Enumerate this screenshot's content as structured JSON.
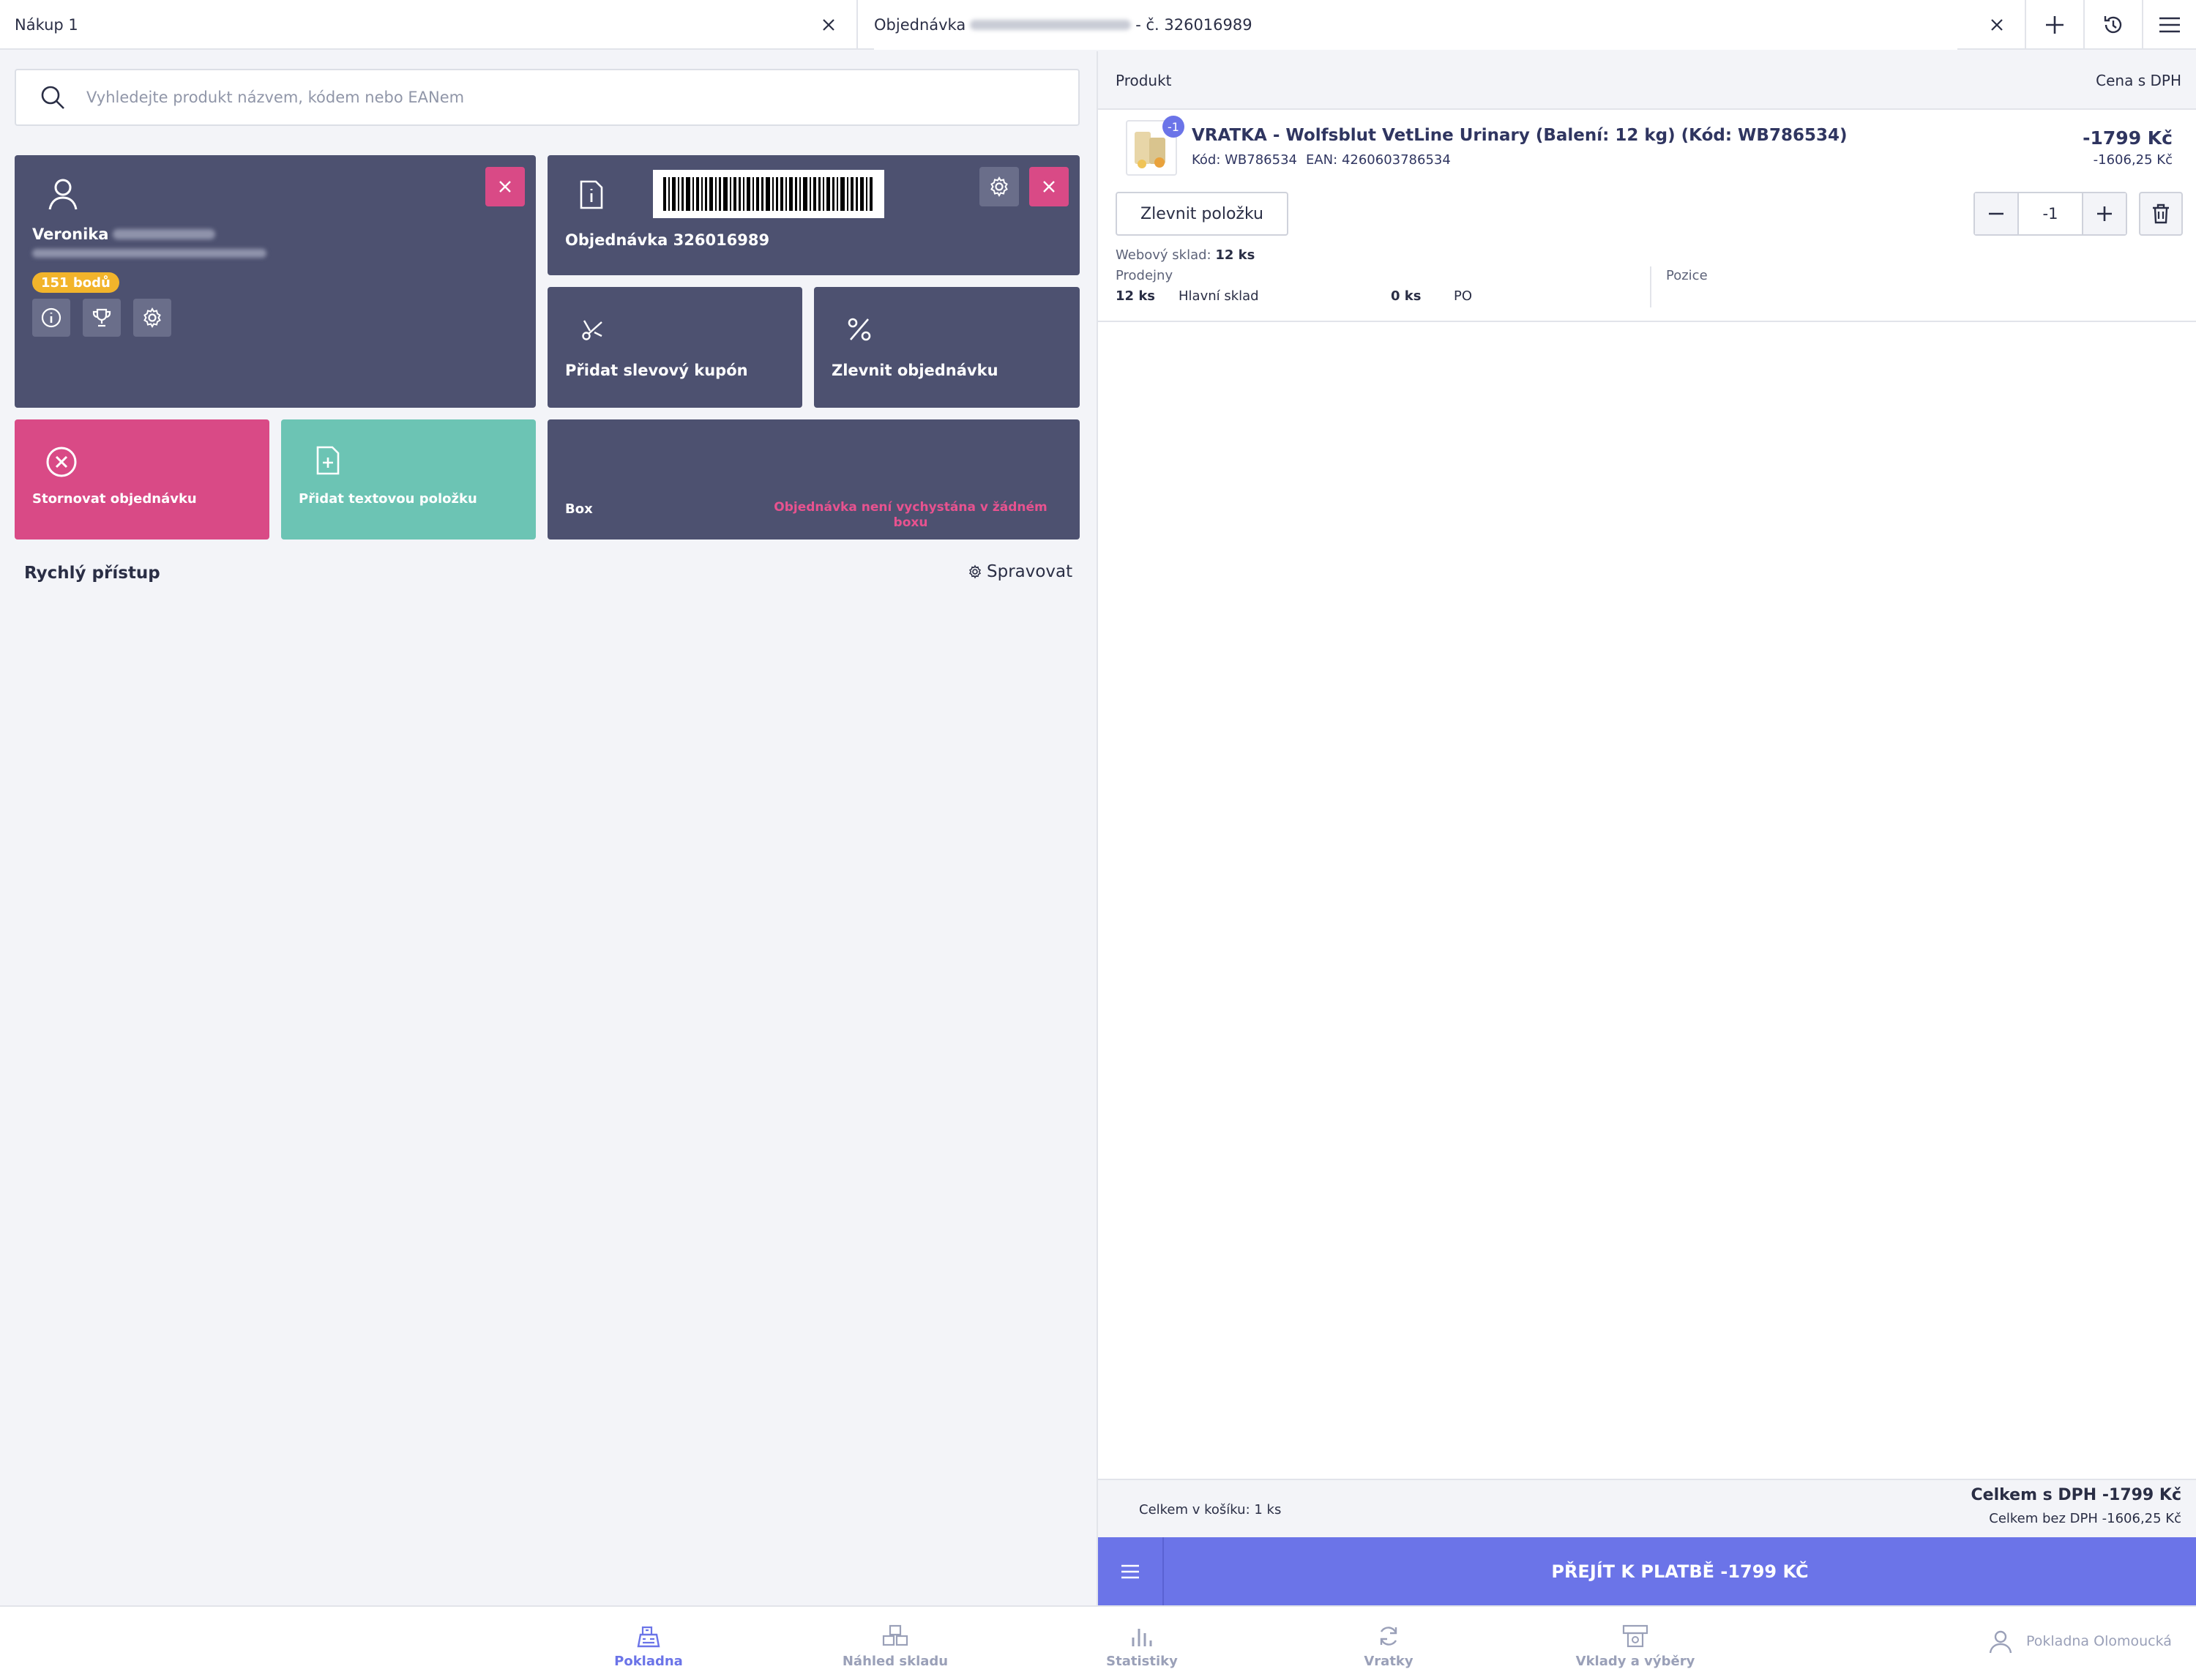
{
  "tabs": {
    "tab1_label": "Nákup 1",
    "tab2_prefix": "Objednávka",
    "tab2_suffix": "- č. 326016989"
  },
  "search": {
    "placeholder": "Vyhledejte produkt názvem, kódem nebo EANem"
  },
  "customer": {
    "first_name": "Veronika",
    "points": "151 bodů"
  },
  "order_tile": {
    "title": "Objednávka 326016989"
  },
  "actions": {
    "coupon": "Přidat slevový kupón",
    "discount_order": "Zlevnit objednávku",
    "cancel_order": "Stornovat objednávku",
    "add_text_item": "Přidat textovou položku"
  },
  "box": {
    "label": "Box",
    "status": "Objednávka není vychystána v žádném boxu"
  },
  "quick_access": {
    "title": "Rychlý přístup",
    "manage": "Spravovat"
  },
  "cart": {
    "col_product": "Produkt",
    "col_price": "Cena s DPH",
    "item": {
      "badge": "-1",
      "name": "VRATKA - Wolfsblut VetLine Urinary (Balení: 12 kg) (Kód: WB786534)",
      "code": "Kód: WB786534",
      "ean": "EAN: 4260603786534",
      "price": "-1799 Kč",
      "price_without_vat": "-1606,25 Kč",
      "discount_button": "Zlevnit položku",
      "quantity": "-1",
      "web_stock_label": "Webový sklad:",
      "web_stock_value": "12 ks",
      "stores_label": "Prodejny",
      "positions_label": "Pozice",
      "store_qty": "12 ks",
      "store_name": "Hlavní sklad",
      "store2_qty": "0 ks",
      "store2_name": "PO"
    },
    "total_count": "Celkem v košíku: 1 ks",
    "total_with_vat": "Celkem s DPH -1799 Kč",
    "total_without_vat": "Celkem bez DPH -1606,25 Kč",
    "pay_button": "PŘEJÍT K PLATBĚ -1799 KČ"
  },
  "nav": {
    "pos": "Pokladna",
    "warehouse": "Náhled skladu",
    "stats": "Statistiky",
    "returns": "Vratky",
    "deposits": "Vklady a výběry",
    "register": "Pokladna Olomoucká"
  },
  "colors": {
    "accent": "#6b74e8",
    "tile": "#4d5170",
    "danger": "#d94a86",
    "success": "#6cc4b4",
    "points_badge": "#f2b42b"
  }
}
